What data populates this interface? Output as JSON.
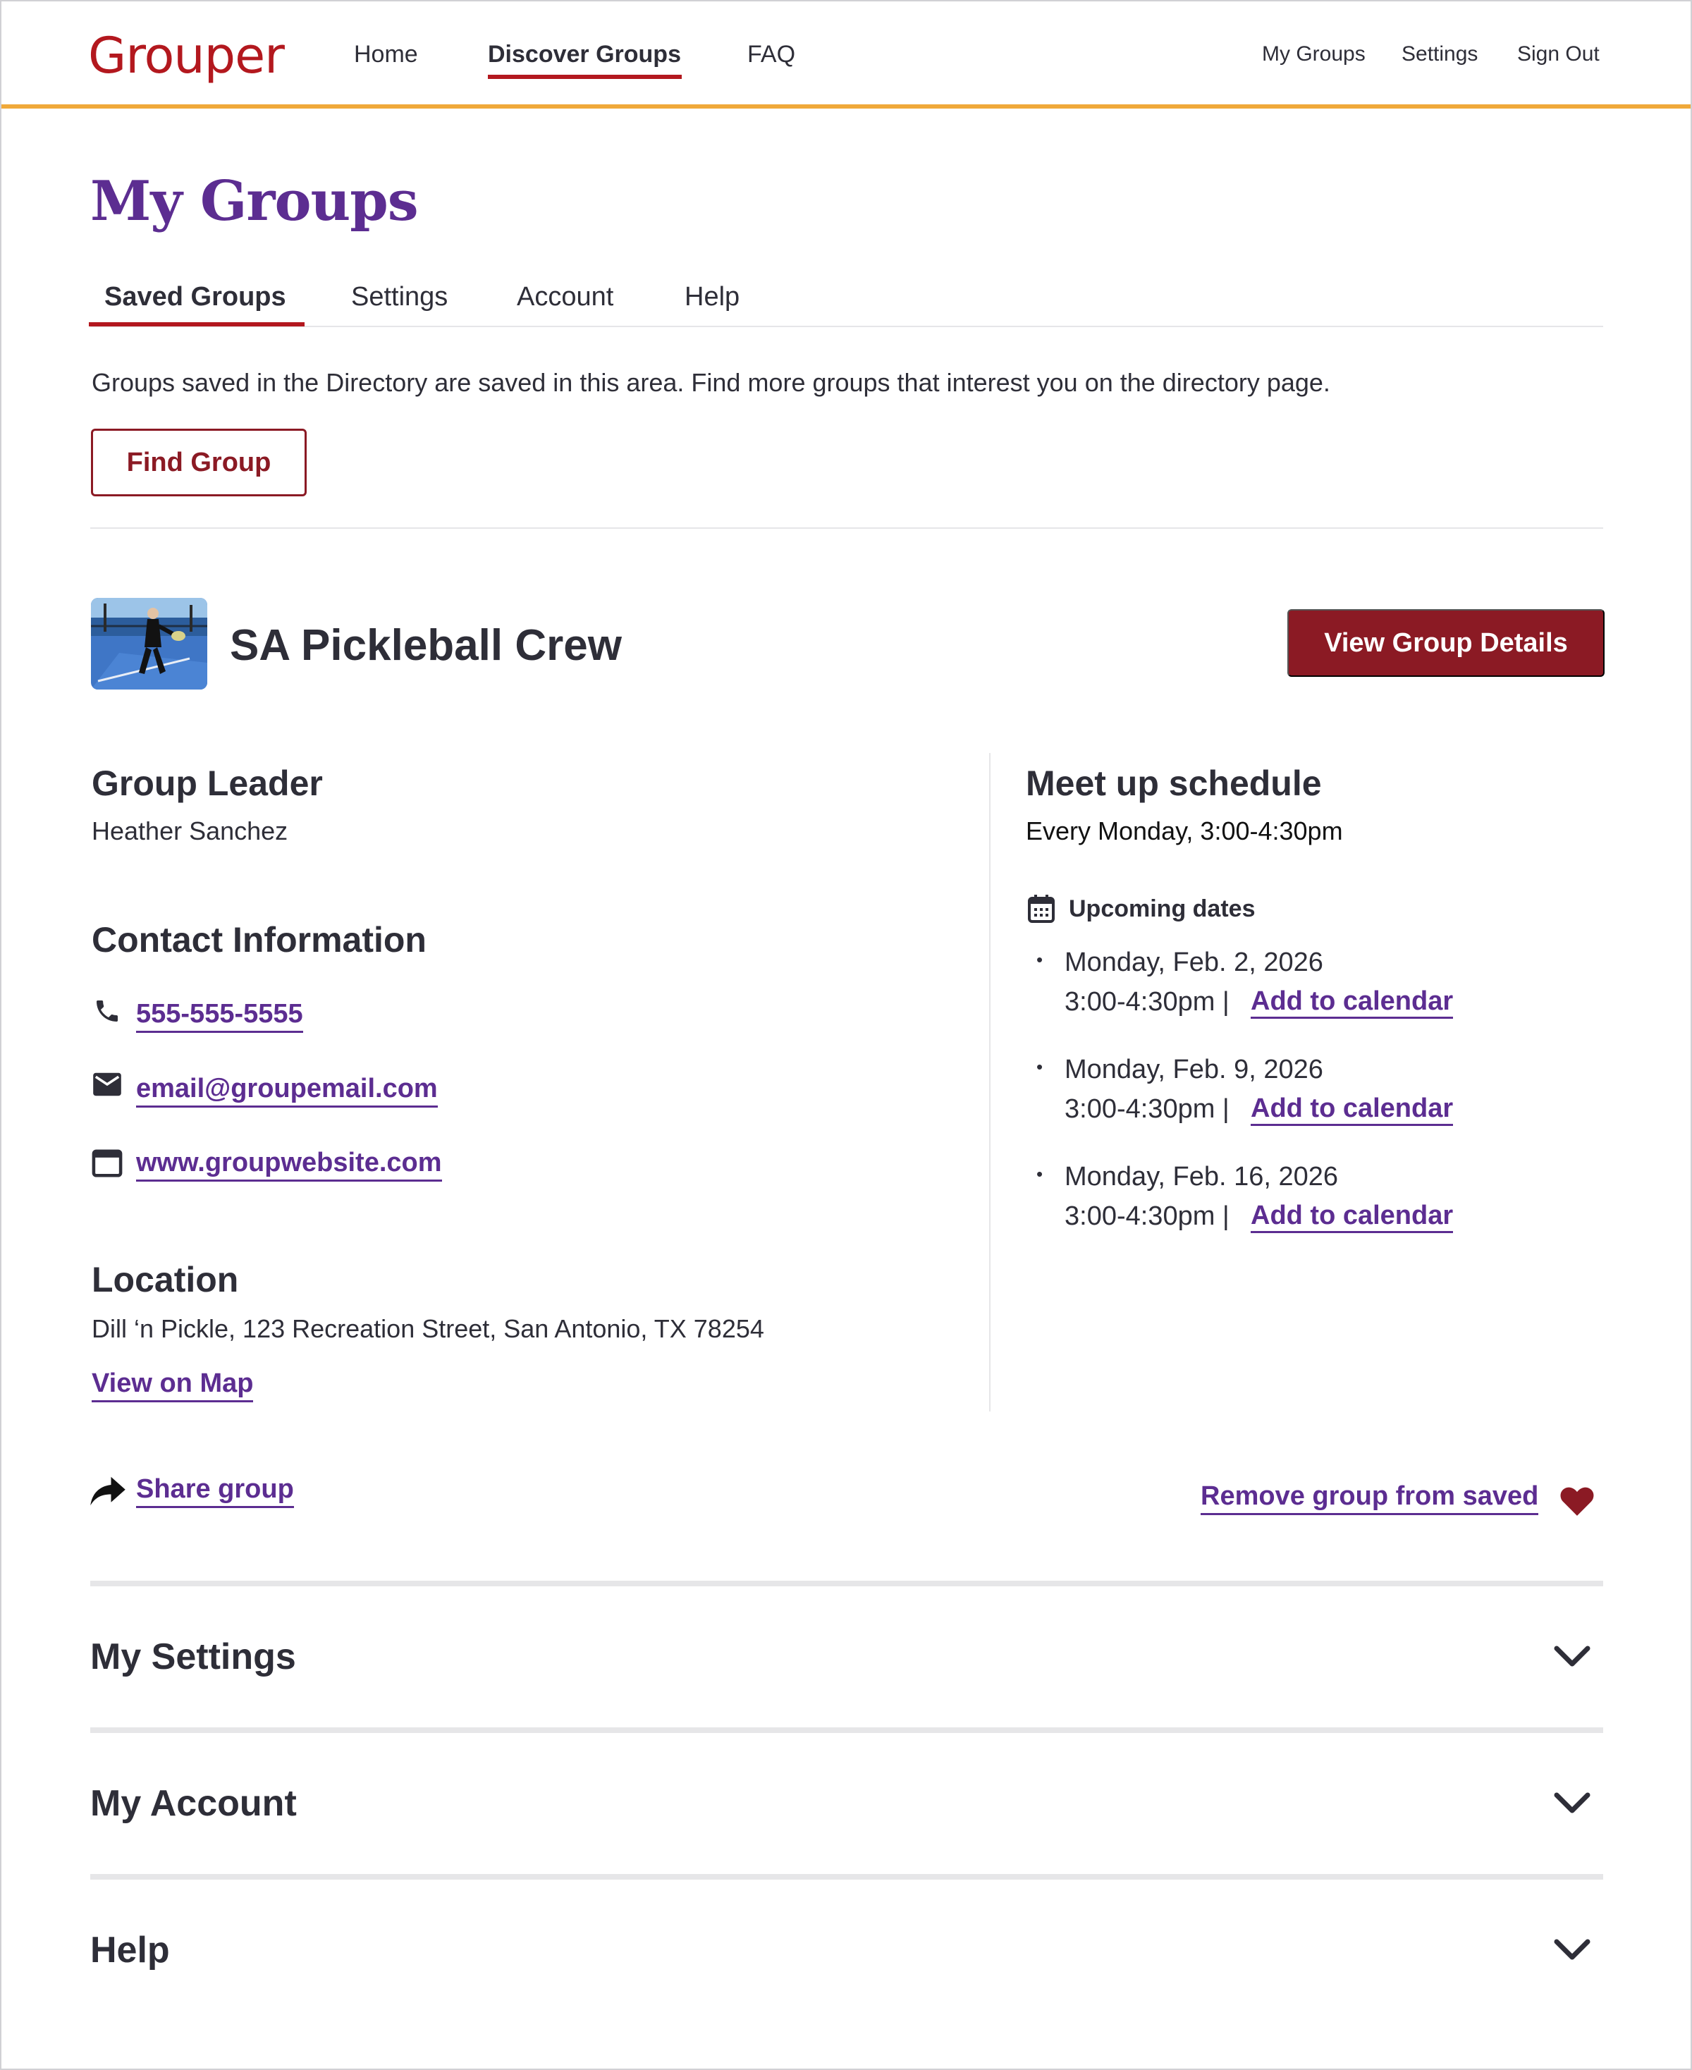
{
  "brand": {
    "logo_text": "Grouper",
    "primary_color": "#b3181e",
    "accent_color": "#5c2d91",
    "button_color": "#8b1a24",
    "header_rule_color": "#f0a93a"
  },
  "nav": {
    "home": "Home",
    "discover": "Discover Groups",
    "faq": "FAQ",
    "active": "Discover Groups"
  },
  "utility_nav": {
    "my_groups": "My Groups",
    "settings": "Settings",
    "sign_out": "Sign Out"
  },
  "page": {
    "title": "My Groups"
  },
  "tabs": [
    {
      "label": "Saved Groups",
      "active": true
    },
    {
      "label": "Settings",
      "active": false
    },
    {
      "label": "Account",
      "active": false
    },
    {
      "label": "Help",
      "active": false
    }
  ],
  "saved": {
    "intro": "Groups saved in the Directory are saved in this area. Find more groups that interest you on the directory page.",
    "find_button": "Find Group"
  },
  "group": {
    "name": "SA Pickleball Crew",
    "view_button": "View Group Details",
    "leader_heading": "Group Leader",
    "leader_name": "Heather Sanchez",
    "contact_heading": "Contact Information",
    "phone": "555-555-5555",
    "email": "email@groupemail.com",
    "website": "www.groupwebsite.com",
    "location_heading": "Location",
    "location": "Dill ‘n Pickle, 123 Recreation Street, San Antonio, TX 78254",
    "map_link": "View on Map",
    "schedule_heading": "Meet up schedule",
    "schedule": "Every Monday, 3:00-4:30pm",
    "upcoming_label": "Upcoming dates",
    "upcoming": [
      {
        "date": "Monday, Feb. 2, 2026",
        "time": "3:00-4:30pm |",
        "link": "Add to calendar"
      },
      {
        "date": "Monday, Feb. 9, 2026",
        "time": "3:00-4:30pm |",
        "link": "Add to calendar"
      },
      {
        "date": "Monday, Feb. 16, 2026",
        "time": "3:00-4:30pm |",
        "link": "Add to calendar"
      }
    ],
    "share_link": "Share group",
    "remove_link": "Remove group from saved",
    "icons": [
      "phone-icon",
      "mail-icon",
      "browser-window-icon",
      "calendar-icon",
      "share-arrow-icon",
      "heart-icon"
    ]
  },
  "accordions": [
    {
      "title": "My Settings"
    },
    {
      "title": "My Account"
    },
    {
      "title": "Help"
    }
  ]
}
